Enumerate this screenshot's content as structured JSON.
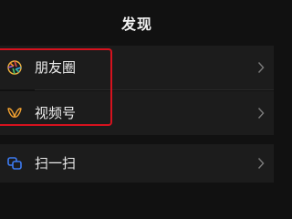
{
  "header": {
    "title": "发现"
  },
  "menu": {
    "items": [
      {
        "label": "朋友圈",
        "icon": "moments-aperture-icon"
      },
      {
        "label": "视频号",
        "icon": "channels-butterfly-icon"
      },
      {
        "label": "扫一扫",
        "icon": "scan-icon"
      }
    ]
  },
  "colors": {
    "background": "#111111",
    "row_background": "#1c1c1c",
    "highlight_border": "#d6121e",
    "channels_icon": "#f0a030",
    "scan_icon": "#3d7bf2"
  }
}
